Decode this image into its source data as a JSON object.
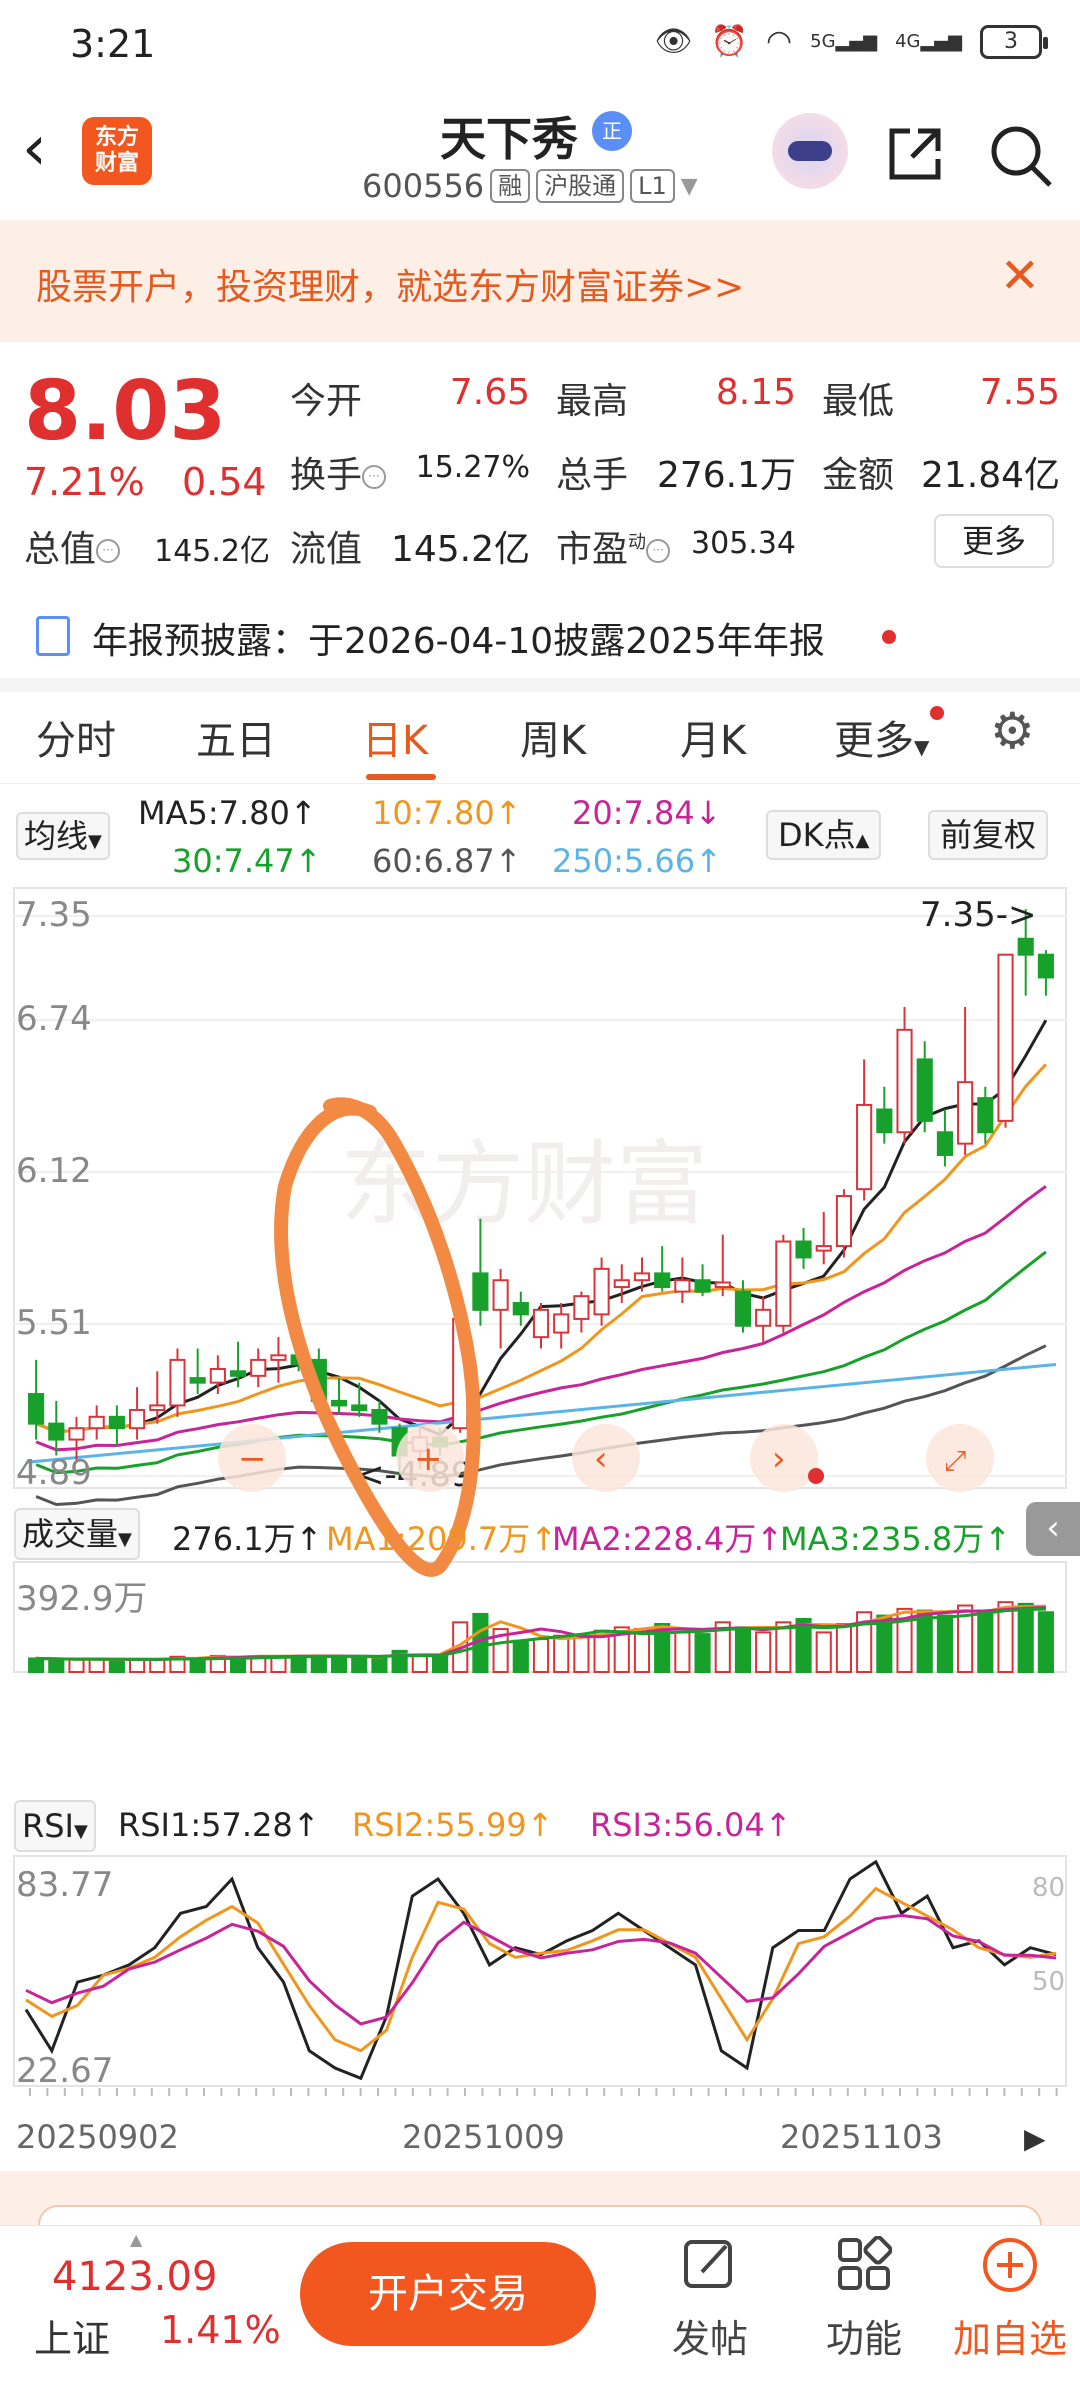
{
  "status_bar": {
    "time": "3:21",
    "signal_1": "5G",
    "signal_2": "4G",
    "battery": "3"
  },
  "header": {
    "logo_text_1": "东方",
    "logo_text_2": "财富",
    "stock_name": "天下秀",
    "badge": "正",
    "code": "600556",
    "tag_rong": "融",
    "tag_market": "沪股通",
    "tag_level": "L1"
  },
  "banner": {
    "text": "股票开户，投资理财，就选东方财富证券>>"
  },
  "quote": {
    "price": "8.03",
    "change_pct": "7.21%",
    "change": "0.54",
    "open_label": "今开",
    "open": "7.65",
    "high_label": "最高",
    "high": "8.15",
    "low_label": "最低",
    "low": "7.55",
    "turnover_label": "换手",
    "turnover": "15.27%",
    "volume_label": "总手",
    "volume": "276.1万",
    "amount_label": "金额",
    "amount": "21.84亿",
    "mcap_label": "总值",
    "mcap": "145.2亿",
    "float_label": "流值",
    "float": "145.2亿",
    "pe_label": "市盈",
    "pe_sup": "动",
    "pe": "305.34",
    "more": "更多"
  },
  "notice": {
    "text": "年报预披露：于2026-04-10披露2025年年报"
  },
  "tabs": [
    "分时",
    "五日",
    "日K",
    "周K",
    "月K",
    "更多"
  ],
  "ma_legend": {
    "btn": "均线",
    "ma5": "MA5:7.80↑",
    "ma10": "10:7.80↑",
    "ma20": "20:7.84↓",
    "ma30": "30:7.47↑",
    "ma60": "60:6.87↑",
    "ma250": "250:5.66↑",
    "dk": "DK点",
    "fq": "前复权"
  },
  "colors": {
    "ma5": "#222222",
    "ma10": "#f0961e",
    "ma20": "#c8249a",
    "ma30": "#17a12a",
    "ma60": "#555555",
    "ma250": "#5ab4e6",
    "up": "#d8343a",
    "down": "#17a12a",
    "accent": "#f2571f"
  },
  "kline": {
    "y_labels": [
      "7.35",
      "6.74",
      "6.12",
      "5.51",
      "4.89"
    ],
    "ylim": [
      4.89,
      7.35
    ],
    "max_marker": "7.35->",
    "min_marker": "<-4.89",
    "watermark": "东方财富"
  },
  "volume": {
    "btn": "成交量",
    "total": "276.1万↑",
    "ma1": "MA1:209.7万↑",
    "ma2": "MA2:228.4万↑",
    "ma3": "MA3:235.8万↑",
    "y_max_label": "392.9万"
  },
  "rsi": {
    "btn": "RSI",
    "rsi1": "RSI1:57.28↑",
    "rsi2": "RSI2:55.99↑",
    "rsi3": "RSI3:56.04↑",
    "y_top": "83.77",
    "y_bottom": "22.67",
    "level_80": "80",
    "level_50": "50"
  },
  "x_labels": [
    "20250902",
    "20251009",
    "20251103"
  ],
  "bottom": {
    "index_value": "4123.09",
    "index_name": "上证",
    "index_pct": "1.41%",
    "trade": "开户交易",
    "post": "发帖",
    "func": "功能",
    "watch": "加自选"
  },
  "chart_data": {
    "type": "candlestick",
    "candles": [
      {
        "o": 5.25,
        "h": 5.4,
        "l": 5.05,
        "c": 5.12
      },
      {
        "o": 5.12,
        "h": 5.22,
        "l": 4.98,
        "c": 5.05
      },
      {
        "o": 5.05,
        "h": 5.15,
        "l": 4.96,
        "c": 5.1
      },
      {
        "o": 5.1,
        "h": 5.2,
        "l": 5.05,
        "c": 5.15
      },
      {
        "o": 5.15,
        "h": 5.2,
        "l": 5.02,
        "c": 5.1
      },
      {
        "o": 5.1,
        "h": 5.28,
        "l": 5.05,
        "c": 5.18
      },
      {
        "o": 5.18,
        "h": 5.35,
        "l": 5.12,
        "c": 5.2
      },
      {
        "o": 5.2,
        "h": 5.45,
        "l": 5.15,
        "c": 5.4
      },
      {
        "o": 5.32,
        "h": 5.45,
        "l": 5.25,
        "c": 5.3
      },
      {
        "o": 5.3,
        "h": 5.42,
        "l": 5.25,
        "c": 5.36
      },
      {
        "o": 5.35,
        "h": 5.48,
        "l": 5.28,
        "c": 5.33
      },
      {
        "o": 5.33,
        "h": 5.45,
        "l": 5.28,
        "c": 5.4
      },
      {
        "o": 5.4,
        "h": 5.5,
        "l": 5.3,
        "c": 5.42
      },
      {
        "o": 5.42,
        "h": 5.45,
        "l": 5.35,
        "c": 5.38
      },
      {
        "o": 5.4,
        "h": 5.45,
        "l": 5.18,
        "c": 5.22
      },
      {
        "o": 5.22,
        "h": 5.32,
        "l": 5.16,
        "c": 5.2
      },
      {
        "o": 5.2,
        "h": 5.3,
        "l": 5.15,
        "c": 5.18
      },
      {
        "o": 5.18,
        "h": 5.22,
        "l": 5.08,
        "c": 5.12
      },
      {
        "o": 5.1,
        "h": 5.12,
        "l": 4.89,
        "c": 4.98
      },
      {
        "o": 5.0,
        "h": 5.1,
        "l": 4.92,
        "c": 5.06
      },
      {
        "o": 5.06,
        "h": 5.1,
        "l": 4.98,
        "c": 5.02
      },
      {
        "o": 5.1,
        "h": 5.6,
        "l": 5.08,
        "c": 5.58
      },
      {
        "o": 5.78,
        "h": 6.02,
        "l": 5.55,
        "c": 5.62
      },
      {
        "o": 5.62,
        "h": 5.8,
        "l": 5.45,
        "c": 5.75
      },
      {
        "o": 5.65,
        "h": 5.7,
        "l": 5.55,
        "c": 5.6
      },
      {
        "o": 5.5,
        "h": 5.65,
        "l": 5.45,
        "c": 5.62
      },
      {
        "o": 5.52,
        "h": 5.65,
        "l": 5.45,
        "c": 5.6
      },
      {
        "o": 5.58,
        "h": 5.7,
        "l": 5.52,
        "c": 5.68
      },
      {
        "o": 5.6,
        "h": 5.85,
        "l": 5.55,
        "c": 5.8
      },
      {
        "o": 5.72,
        "h": 5.82,
        "l": 5.65,
        "c": 5.75
      },
      {
        "o": 5.75,
        "h": 5.85,
        "l": 5.7,
        "c": 5.78
      },
      {
        "o": 5.78,
        "h": 5.9,
        "l": 5.7,
        "c": 5.72
      },
      {
        "o": 5.7,
        "h": 5.85,
        "l": 5.65,
        "c": 5.75
      },
      {
        "o": 5.75,
        "h": 5.82,
        "l": 5.68,
        "c": 5.7
      },
      {
        "o": 5.72,
        "h": 5.95,
        "l": 5.68,
        "c": 5.74
      },
      {
        "o": 5.7,
        "h": 5.75,
        "l": 5.52,
        "c": 5.55
      },
      {
        "o": 5.55,
        "h": 5.68,
        "l": 5.48,
        "c": 5.62
      },
      {
        "o": 5.55,
        "h": 5.95,
        "l": 5.52,
        "c": 5.92
      },
      {
        "o": 5.92,
        "h": 5.98,
        "l": 5.8,
        "c": 5.85
      },
      {
        "o": 5.88,
        "h": 6.05,
        "l": 5.82,
        "c": 5.9
      },
      {
        "o": 5.9,
        "h": 6.15,
        "l": 5.85,
        "c": 6.12
      },
      {
        "o": 6.15,
        "h": 6.72,
        "l": 6.1,
        "c": 6.52
      },
      {
        "o": 6.5,
        "h": 6.6,
        "l": 6.35,
        "c": 6.4
      },
      {
        "o": 6.4,
        "h": 6.95,
        "l": 6.35,
        "c": 6.85
      },
      {
        "o": 6.72,
        "h": 6.8,
        "l": 6.4,
        "c": 6.45
      },
      {
        "o": 6.4,
        "h": 6.5,
        "l": 6.25,
        "c": 6.3
      },
      {
        "o": 6.35,
        "h": 6.95,
        "l": 6.3,
        "c": 6.62
      },
      {
        "o": 6.55,
        "h": 6.6,
        "l": 6.35,
        "c": 6.4
      },
      {
        "o": 6.45,
        "h": 7.18,
        "l": 6.42,
        "c": 7.18
      },
      {
        "o": 7.25,
        "h": 7.38,
        "l": 7.0,
        "c": 7.18
      },
      {
        "o": 7.18,
        "h": 7.2,
        "l": 7.0,
        "c": 7.08
      }
    ],
    "volume": [
      45,
      40,
      38,
      42,
      35,
      40,
      38,
      55,
      45,
      60,
      55,
      58,
      60,
      58,
      62,
      58,
      50,
      55,
      90,
      60,
      58,
      260,
      310,
      220,
      150,
      160,
      180,
      170,
      210,
      230,
      220,
      250,
      200,
      190,
      260,
      230,
      200,
      260,
      280,
      200,
      250,
      320,
      300,
      340,
      330,
      300,
      360,
      310,
      380,
      370,
      320
    ],
    "rsi1": [
      42,
      30,
      50,
      52,
      55,
      60,
      70,
      72,
      80,
      60,
      50,
      30,
      25,
      22,
      40,
      75,
      80,
      70,
      55,
      60,
      58,
      62,
      65,
      70,
      65,
      60,
      55,
      30,
      25,
      60,
      65,
      65,
      80,
      85,
      70,
      75,
      60,
      62,
      55,
      60,
      58
    ]
  }
}
